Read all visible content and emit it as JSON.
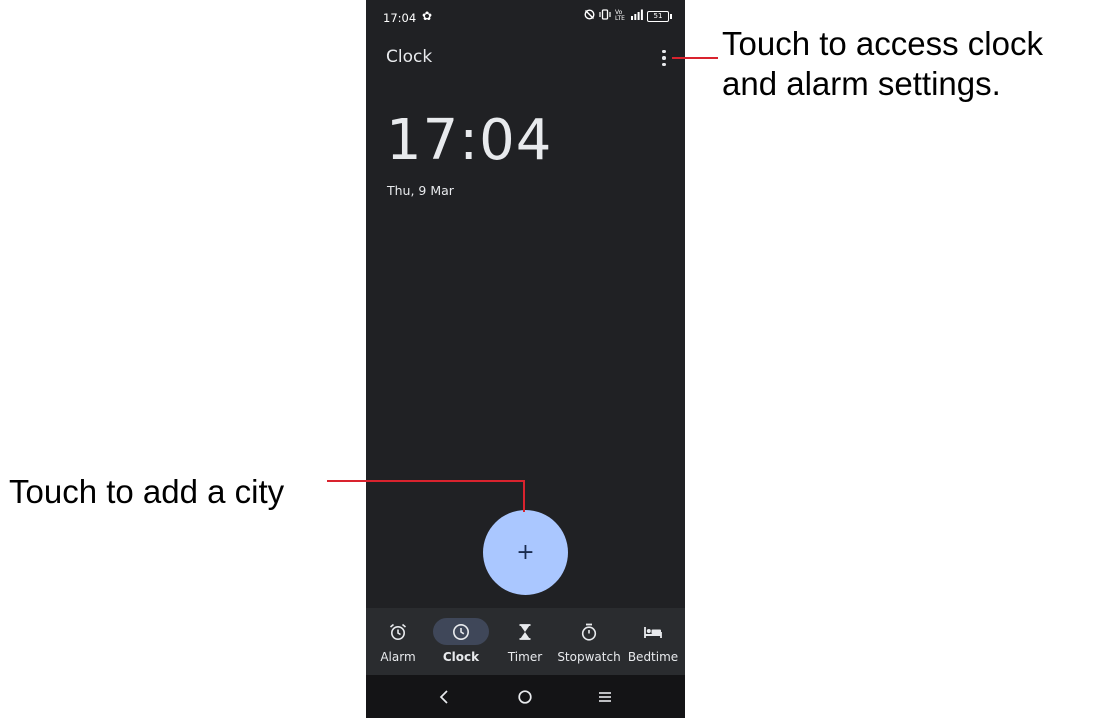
{
  "status_bar": {
    "time": "17:04",
    "signal_text": "Vo LTE",
    "battery_level": "51"
  },
  "app": {
    "title": "Clock",
    "current_time": "17:04",
    "current_date": "Thu, 9 Mar",
    "fab_label": "+"
  },
  "bottom_nav": {
    "items": [
      {
        "label": "Alarm",
        "icon": "alarm-icon",
        "active": false
      },
      {
        "label": "Clock",
        "icon": "clock-icon",
        "active": true
      },
      {
        "label": "Timer",
        "icon": "hourglass-icon",
        "active": false
      },
      {
        "label": "Stopwatch",
        "icon": "stopwatch-icon",
        "active": false
      },
      {
        "label": "Bedtime",
        "icon": "bed-icon",
        "active": false
      }
    ]
  },
  "annotations": {
    "settings_callout_line1": "Touch to access clock",
    "settings_callout_line2": "and alarm settings.",
    "add_city_callout": "Touch to add a city"
  },
  "colors": {
    "background": "#202124",
    "fab": "#aac7ff",
    "callout_line": "#d9232e"
  }
}
